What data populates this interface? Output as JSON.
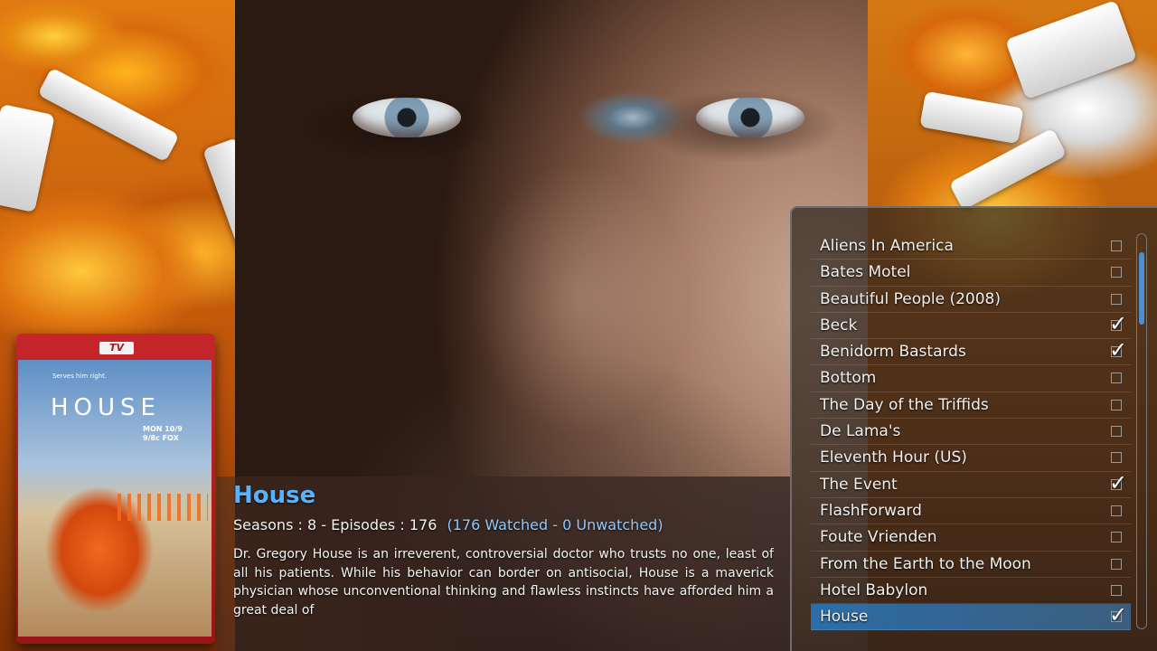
{
  "poster": {
    "badge": "TV",
    "tagline": "Serves him right.",
    "title": "HOUSE",
    "airing_line1": "MON 10/9",
    "airing_line2": "9/8c FOX"
  },
  "info": {
    "title": "House",
    "stats": "Seasons : 8 - Episodes : 176",
    "watched": "(176 Watched -  0 Unwatched)",
    "plot": "Dr. Gregory House is an irreverent, controversial doctor who trusts no one, least of all his patients. While his behavior can border on antisocial, House is a maverick physician whose unconventional thinking and flawless instincts have afforded him a great deal of"
  },
  "list": {
    "items": [
      {
        "label": "Aliens In America",
        "watched": false,
        "selected": false
      },
      {
        "label": "Bates Motel",
        "watched": false,
        "selected": false
      },
      {
        "label": "Beautiful People (2008)",
        "watched": false,
        "selected": false
      },
      {
        "label": "Beck",
        "watched": true,
        "selected": false
      },
      {
        "label": "Benidorm Bastards",
        "watched": true,
        "selected": false
      },
      {
        "label": "Bottom",
        "watched": false,
        "selected": false
      },
      {
        "label": "The Day of the Triffids",
        "watched": false,
        "selected": false
      },
      {
        "label": "De Lama's",
        "watched": false,
        "selected": false
      },
      {
        "label": "Eleventh Hour (US)",
        "watched": false,
        "selected": false
      },
      {
        "label": "The Event",
        "watched": true,
        "selected": false
      },
      {
        "label": "FlashForward",
        "watched": false,
        "selected": false
      },
      {
        "label": "Foute Vrienden",
        "watched": false,
        "selected": false
      },
      {
        "label": "From the Earth to the Moon",
        "watched": false,
        "selected": false
      },
      {
        "label": "Hotel Babylon",
        "watched": false,
        "selected": false
      },
      {
        "label": "House",
        "watched": true,
        "selected": true
      }
    ],
    "check_glyph": "✓"
  }
}
